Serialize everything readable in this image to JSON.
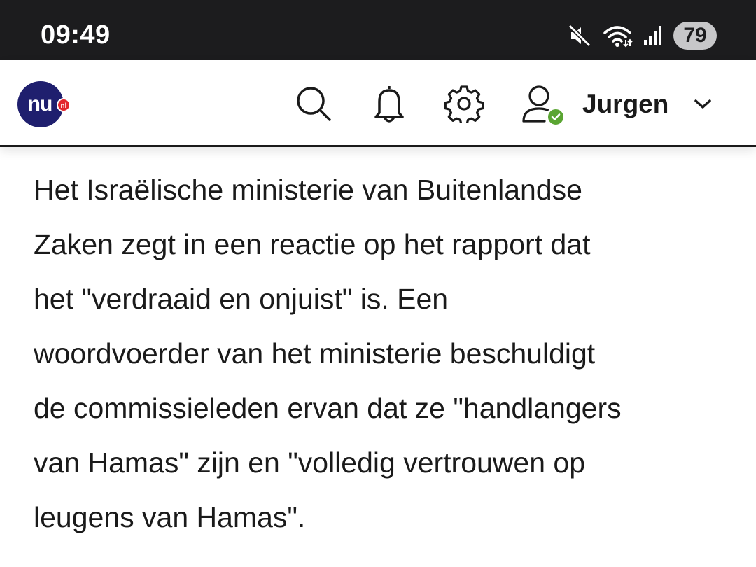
{
  "status_bar": {
    "time": "09:49",
    "battery": "79",
    "icons": [
      "mute-icon",
      "wifi-icon",
      "cellular-signal-icon",
      "battery-icon"
    ]
  },
  "header": {
    "logo": {
      "main": "nu",
      "badge": "nl"
    },
    "icons": [
      "search-icon",
      "bell-icon",
      "gear-icon",
      "user-icon"
    ],
    "user_name": "Jurgen",
    "user_status": "verified",
    "accent_logo": "#1f1f6e",
    "accent_badge": "#e3262d",
    "accent_check": "#5aa532"
  },
  "article": {
    "paragraph": "Het Israëlische ministerie van Buitenlandse\nZaken zegt in een reactie op het rapport dat\nhet \"verdraaid en onjuist\" is. Een\nwoordvoerder van het ministerie beschuldigt\nde commissieleden ervan dat ze \"handlangers\nvan Hamas\" zijn en \"volledig vertrouwen op\nleugens van Hamas\"."
  }
}
